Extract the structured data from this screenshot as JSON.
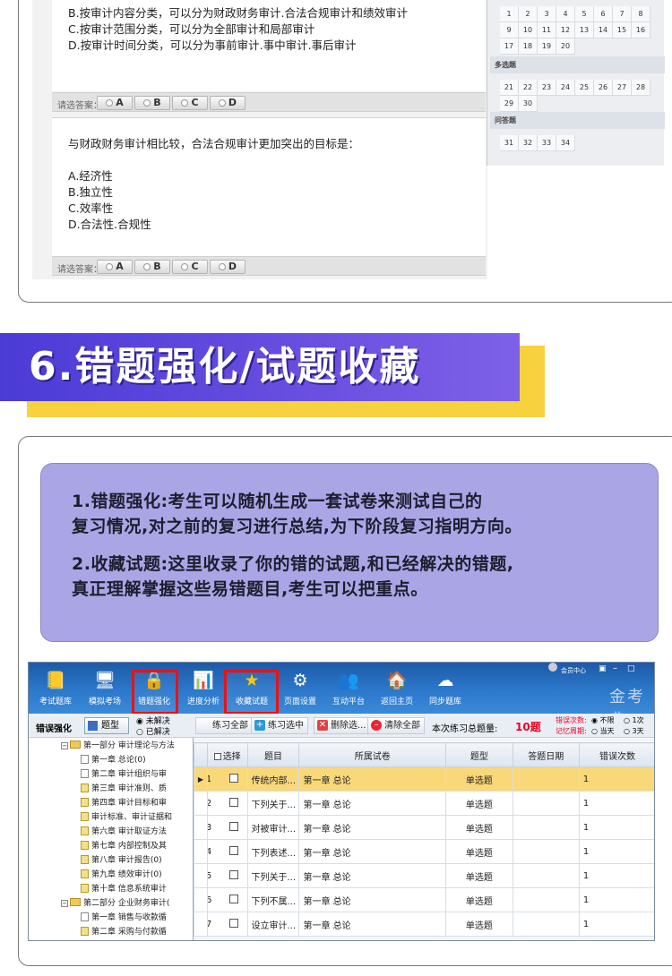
{
  "top_exam": {
    "q1_options": [
      "B.按审计内容分类，可以分为财政财务审计.合法合规审计和绩效审计",
      "C.按审计范围分类，可以分为全部审计和局部审计",
      "D.按审计时间分类，可以分为事前审计.事中审计.事后审计"
    ],
    "answer_label": "请选答案：",
    "answer_options": [
      "A",
      "B",
      "C",
      "D"
    ],
    "q2_stem": "与财政财务审计相比较，合法合规审计更加突出的目标是：",
    "q2_options": [
      "A.经济性",
      "B.独立性",
      "C.效率性",
      "D.合法性.合规性"
    ],
    "grid": {
      "row1": [
        "1",
        "2",
        "3",
        "4",
        "5",
        "6",
        "7",
        "8"
      ],
      "row2": [
        "9",
        "10",
        "11",
        "12",
        "13",
        "14",
        "15",
        "16"
      ],
      "row3": [
        "17",
        "18",
        "19",
        "20"
      ],
      "section_multi": "多选题",
      "row4": [
        "21",
        "22",
        "23",
        "24",
        "25",
        "26",
        "27",
        "28"
      ],
      "row5": [
        "29",
        "30"
      ],
      "section_qa": "问答题",
      "row6": [
        "31",
        "32",
        "33",
        "34"
      ]
    }
  },
  "banner": {
    "title": "6.错题强化/试题收藏"
  },
  "description": {
    "para1_line1": "1.错题强化:考生可以随机生成一套试卷来测试自己的",
    "para1_line2": "复习情况,对之前的复习进行总结,为下阶段复习指明方向。",
    "para2_line1": "2.收藏试题:这里收录了你的错的试题,和已经解决的错题,",
    "para2_line2": "真正理解掌握这些易错题目,考生可以把重点。"
  },
  "app": {
    "toolbar": [
      "考试题库",
      "模拟考场",
      "错题强化",
      "进度分析",
      "收藏试题",
      "页面设置",
      "互动平台",
      "返回主页",
      "同步题库"
    ],
    "brand": "金考典",
    "member_center": "会员中心",
    "sidebar": {
      "title": "错误强化",
      "type_button": "题型",
      "radio_unsolved": "未解决",
      "radio_solved": "已解决",
      "tree": [
        {
          "label": "第一部分  审计理论与方法",
          "kind": "part"
        },
        {
          "label": "第一章  总论(0)",
          "kind": "blank"
        },
        {
          "label": "第二章  审计组织与审",
          "kind": "blank"
        },
        {
          "label": "第三章  审计准则、质",
          "kind": "doc"
        },
        {
          "label": "第四章  审计目标和审",
          "kind": "doc"
        },
        {
          "label": "审计标准、审计证据和",
          "kind": "doc"
        },
        {
          "label": "第六章  审计取证方法",
          "kind": "doc"
        },
        {
          "label": "第七章  内部控制及其",
          "kind": "doc"
        },
        {
          "label": "第八章  审计报告(0)",
          "kind": "doc"
        },
        {
          "label": "第九章  绩效审计(0)",
          "kind": "doc"
        },
        {
          "label": "第十章  信息系统审计",
          "kind": "doc"
        },
        {
          "label": "第二部分  企业财务审计(",
          "kind": "part"
        },
        {
          "label": "第一章  销售与收款循",
          "kind": "blank"
        },
        {
          "label": "第二章  采购与付款循",
          "kind": "doc"
        }
      ]
    },
    "actions": {
      "practice_all": "练习全部",
      "practice_selected": "练习选中",
      "delete_selected": "删除选...",
      "clear_all": "清除全部",
      "total_label": "本次练习总题量:",
      "total_value": "10题",
      "wrong_count_label": "错误次数:",
      "wrong_opts": [
        "不限",
        "1次"
      ],
      "memory_label": "记忆周期:",
      "memory_opts": [
        "当天",
        "3天"
      ]
    },
    "table": {
      "headers": [
        "",
        "选择",
        "题目",
        "所属试卷",
        "题型",
        "答题日期",
        "错误次数"
      ],
      "rows": [
        {
          "num": "1",
          "title": "传统内部...",
          "paper": "第一章 总论",
          "type": "单选题",
          "date": "",
          "wrong": "1"
        },
        {
          "num": "2",
          "title": "下列关于...",
          "paper": "第一章 总论",
          "type": "单选题",
          "date": "",
          "wrong": "1"
        },
        {
          "num": "3",
          "title": "对被审计...",
          "paper": "第一章 总论",
          "type": "单选题",
          "date": "",
          "wrong": "1"
        },
        {
          "num": "4",
          "title": "下列表述...",
          "paper": "第一章 总论",
          "type": "单选题",
          "date": "",
          "wrong": "1"
        },
        {
          "num": "5",
          "title": "下列关于...",
          "paper": "第一章 总论",
          "type": "单选题",
          "date": "",
          "wrong": "1"
        },
        {
          "num": "6",
          "title": "下列不属...",
          "paper": "第一章 总论",
          "type": "单选题",
          "date": "",
          "wrong": "1"
        },
        {
          "num": "7",
          "title": "设立审计...",
          "paper": "第一章 总论",
          "type": "单选题",
          "date": "",
          "wrong": "1"
        }
      ]
    }
  }
}
